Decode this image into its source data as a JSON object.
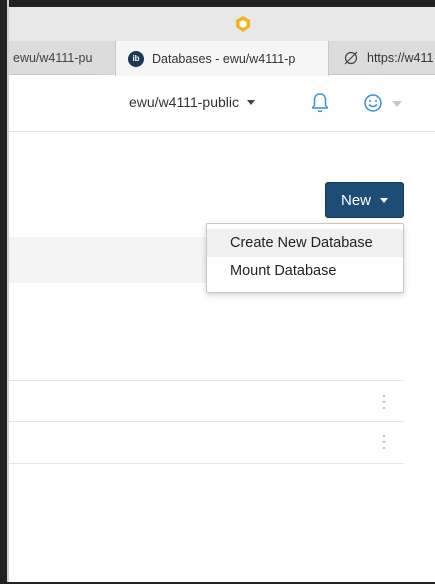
{
  "browser": {
    "tabs": [
      {
        "label": "ewu/w4111-pu",
        "active": false
      },
      {
        "label": "Databases - ewu/w4111-p",
        "active": true,
        "favicon": "ib"
      },
      {
        "label": "https://w411",
        "active": false
      }
    ],
    "extension_icon": "honey-shield-icon"
  },
  "header": {
    "account_label": "ewu/w4111-public",
    "notification_icon": "bell-icon",
    "user_icon": "smiley-icon"
  },
  "main": {
    "new_button_label": "New",
    "menu": {
      "items": [
        {
          "label": "Create New Database",
          "highlighted": true
        },
        {
          "label": "Mount Database",
          "highlighted": false
        }
      ]
    }
  },
  "colors": {
    "primary": "#1d4c75",
    "favicon_bg": "#1e3756",
    "bell": "#3a8dde",
    "smiley": "#3a8dde",
    "extension": "#f5b21b"
  }
}
